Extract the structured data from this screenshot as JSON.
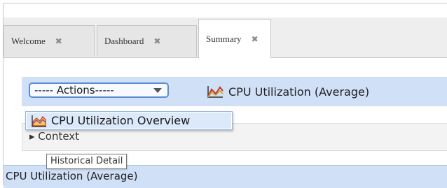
{
  "tabs": [
    {
      "label": "Welcome",
      "close_glyph": "✖"
    },
    {
      "label": "Dashboard",
      "close_glyph": "✖"
    },
    {
      "label": "Summary",
      "close_glyph": "✖",
      "active": true
    }
  ],
  "actions_select": {
    "label": "----- Actions-----"
  },
  "chart_title": "CPU Utilization (Average)",
  "chart_icon": "line-chart-icon",
  "context": {
    "label": "▸ Context"
  },
  "section": {
    "label": "CPU Utilization (Average)"
  },
  "dropdown_menu": {
    "items": [
      {
        "label": "CPU Utilization Overview",
        "icon": "area-chart-icon"
      }
    ]
  },
  "tooltip": {
    "text": "Historical Detail"
  },
  "colors": {
    "accent_blue": "#5b8cd6",
    "bar_background": "#cfe0f7",
    "menu_highlight": "#dce9fb"
  }
}
